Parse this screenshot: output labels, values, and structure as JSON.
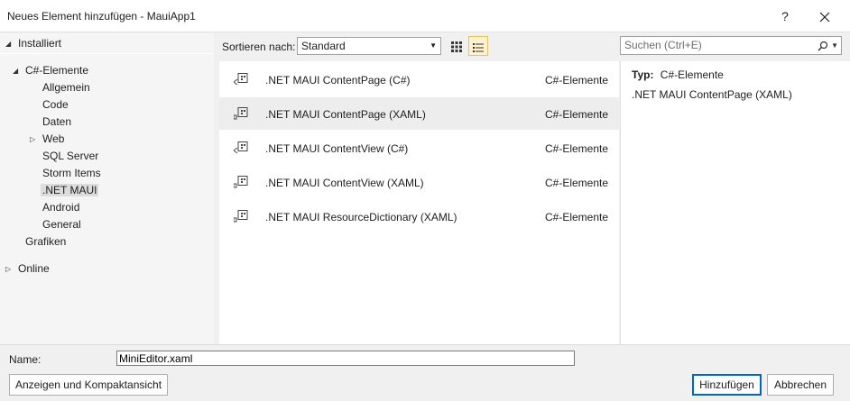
{
  "window": {
    "title": "Neues Element hinzufügen - MauiApp1",
    "help_label": "?",
    "close_label": "✕"
  },
  "tree": {
    "installed": "Installiert",
    "csharp": "C#-Elemente",
    "children": [
      "Allgemein",
      "Code",
      "Daten",
      "Web",
      "SQL Server",
      "Storm Items",
      ".NET MAUI",
      "Android",
      "General"
    ],
    "grafiken": "Grafiken",
    "online": "Online",
    "selected": ".NET MAUI"
  },
  "toolbar": {
    "sort_label": "Sortieren nach:",
    "sort_value": "Standard",
    "search_placeholder": "Suchen (Ctrl+E)"
  },
  "templates": [
    {
      "name": ".NET MAUI ContentPage (C#)",
      "category": "C#-Elemente",
      "icon": "csharp-template-icon"
    },
    {
      "name": ".NET MAUI ContentPage (XAML)",
      "category": "C#-Elemente",
      "icon": "xaml-template-icon"
    },
    {
      "name": ".NET MAUI ContentView (C#)",
      "category": "C#-Elemente",
      "icon": "csharp-template-icon"
    },
    {
      "name": ".NET MAUI ContentView (XAML)",
      "category": "C#-Elemente",
      "icon": "xaml-template-icon"
    },
    {
      "name": ".NET MAUI ResourceDictionary (XAML)",
      "category": "C#-Elemente",
      "icon": "xaml-template-icon"
    }
  ],
  "details": {
    "type_label": "Typ:",
    "type_value": "C#-Elemente",
    "description": ".NET MAUI ContentPage (XAML)"
  },
  "footer": {
    "name_label": "Name:",
    "name_value": "MiniEditor.xaml",
    "compact_button": "Anzeigen und Kompaktansicht",
    "add_button": "Hinzufügen",
    "cancel_button": "Abbrechen"
  },
  "colors": {
    "selection": "#ededed",
    "active_view": "#fff2cc",
    "primary_border": "#0067c0"
  }
}
